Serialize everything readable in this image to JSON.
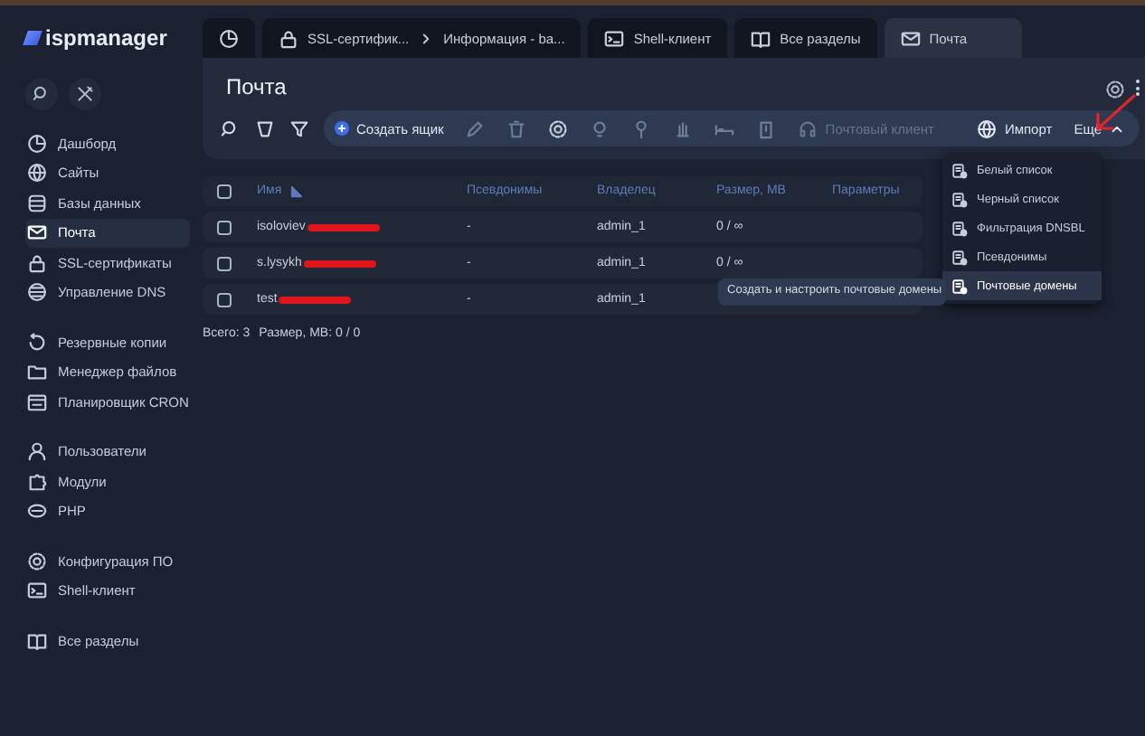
{
  "logo": {
    "text": "ispmanager"
  },
  "tabs": [
    {
      "selected": false
    },
    {
      "label": "SSL-сертифик...",
      "crumb": "Информация - ba...",
      "selected": false
    },
    {
      "label": "Shell-клиент",
      "selected": false
    },
    {
      "label": "Все разделы",
      "selected": false
    },
    {
      "label": "Почта",
      "selected": true
    }
  ],
  "sidebar": {
    "groups": [
      [
        {
          "label": "Дашборд",
          "selected": false
        },
        {
          "label": "Сайты",
          "selected": false
        },
        {
          "label": "Базы данных",
          "selected": false
        },
        {
          "label": "Почта",
          "selected": true
        },
        {
          "label": "SSL-сертификаты",
          "selected": false
        },
        {
          "label": "Управление DNS",
          "selected": false
        }
      ],
      [
        {
          "label": "Резервные копии",
          "selected": false
        },
        {
          "label": "Менеджер файлов",
          "selected": false
        },
        {
          "label": "Планировщик CRON",
          "selected": false
        }
      ],
      [
        {
          "label": "Пользователи",
          "selected": false
        },
        {
          "label": "Модули",
          "selected": false
        },
        {
          "label": "PHP",
          "selected": false
        }
      ],
      [
        {
          "label": "Конфигурация ПО",
          "selected": false
        },
        {
          "label": "Shell-клиент",
          "selected": false
        }
      ],
      [
        {
          "label": "Все разделы",
          "selected": false
        }
      ]
    ]
  },
  "page": {
    "title": "Почта"
  },
  "toolbar": {
    "create": "Создать ящик",
    "mail_client": {
      "label": "Почтовый клиент",
      "disabled": true
    },
    "import": "Импорт",
    "more": {
      "label": "Ещё",
      "expanded": true
    }
  },
  "table": {
    "all_checked": false,
    "columns": [
      "Имя",
      "Псевдонимы",
      "Владелец",
      "Размер, MB",
      "Параметры"
    ],
    "rows": [
      {
        "name": "isoloviev",
        "aliases": "-",
        "owner": "admin_1",
        "size": "0 / ∞",
        "checked": false
      },
      {
        "name": "s.lysykh",
        "aliases": "-",
        "owner": "admin_1",
        "size": "0 / ∞",
        "checked": false
      },
      {
        "name": "test",
        "aliases": "-",
        "owner": "admin_1",
        "checked": false
      }
    ]
  },
  "footer": {
    "total": "Всего: 3",
    "size": "Размер, MB: 0 / 0"
  },
  "menu": [
    {
      "label": "Белый список",
      "selected": false
    },
    {
      "label": "Черный список",
      "selected": false
    },
    {
      "label": "Фильтрация DNSBL",
      "selected": false
    },
    {
      "label": "Псевдонимы",
      "selected": false
    },
    {
      "label": "Почтовые домены",
      "selected": true
    }
  ],
  "tooltip": "Создать и настроить почтовые домены"
}
